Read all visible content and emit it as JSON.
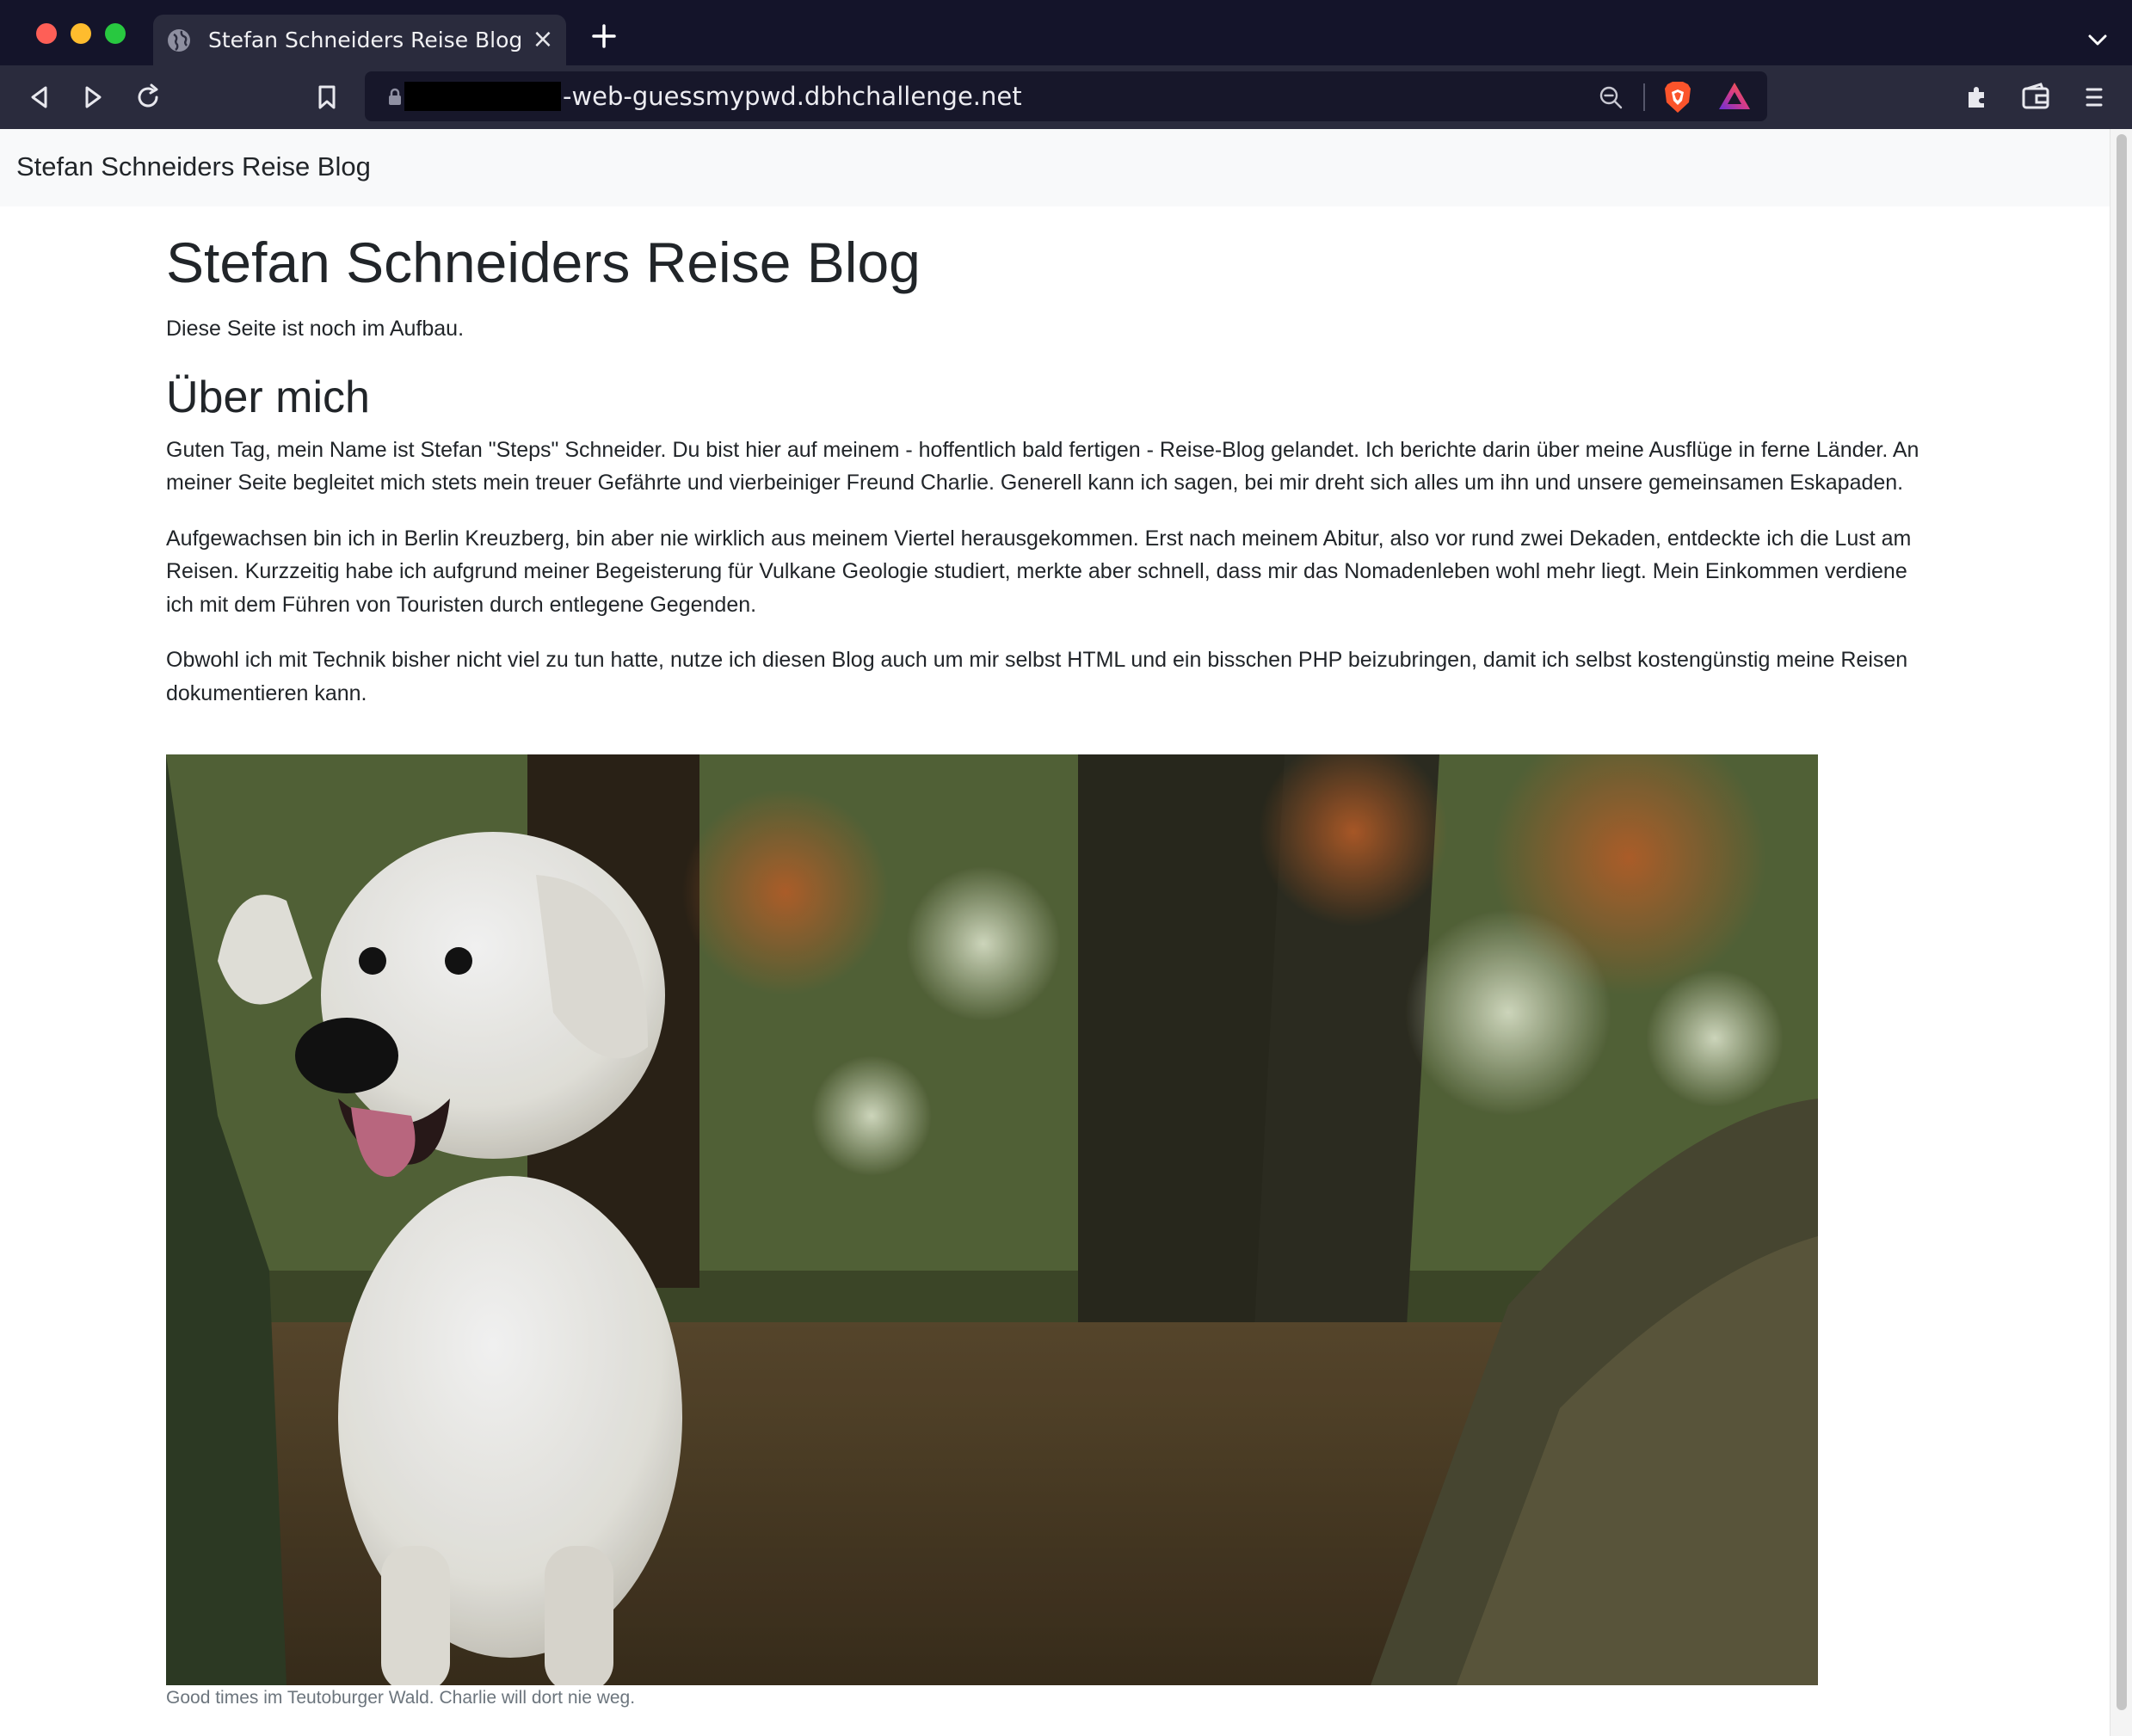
{
  "browser": {
    "tab": {
      "title": "Stefan Schneiders Reise Blog"
    },
    "url": {
      "redacted": true,
      "visible_text": "-web-guessmypwd.dbhchallenge.net"
    },
    "icons": [
      "close-icon",
      "plus-icon",
      "chevron-down-icon",
      "back-icon",
      "forward-icon",
      "reload-icon",
      "bookmark-icon",
      "lock-icon",
      "zoom-out-icon",
      "brave-shield-icon",
      "brave-rewards-icon",
      "extensions-icon",
      "wallet-icon",
      "menu-icon"
    ]
  },
  "navbar": {
    "brand": "Stefan Schneiders Reise Blog"
  },
  "page": {
    "title": "Stefan Schneiders Reise Blog",
    "intro": "Diese Seite ist noch im Aufbau.",
    "about_heading": "Über mich",
    "paragraphs": [
      "Guten Tag, mein Name ist Stefan \"Steps\" Schneider. Du bist hier auf meinem - hoffentlich bald fertigen - Reise-Blog gelandet. Ich berichte darin über meine Ausflüge in ferne Länder. An meiner Seite begleitet mich stets mein treuer Gefährte und vierbeiniger Freund Charlie. Generell kann ich sagen, bei mir dreht sich alles um ihn und unsere gemeinsamen Eskapaden.",
      "Aufgewachsen bin ich in Berlin Kreuzberg, bin aber nie wirklich aus meinem Viertel herausgekommen. Erst nach meinem Abitur, also vor rund zwei Dekaden, entdeckte ich die Lust am Reisen. Kurzzeitig habe ich aufgrund meiner Begeisterung für Vulkane Geologie studiert, merkte aber schnell, dass mir das Nomadenleben wohl mehr liegt. Mein Einkommen verdiene ich mit dem Führen von Touristen durch entlegene Gegenden.",
      "Obwohl ich mit Technik bisher nicht viel zu tun hatte, nutze ich diesen Blog auch um mir selbst HTML und ein bisschen PHP beizubringen, damit ich selbst kostengünstig meine Reisen dokumentieren kann."
    ],
    "photo_caption": "Good times im Teutoburger Wald. Charlie will dort nie weg."
  },
  "colors": {
    "chrome_bg": "#14142a",
    "toolbar_bg": "#2a2b3d",
    "urlbar_bg": "#17172a",
    "navbar_bg": "#f8f9fa",
    "text": "#212529",
    "caption_text": "#6c757d",
    "brave_orange": "#fb542b"
  }
}
